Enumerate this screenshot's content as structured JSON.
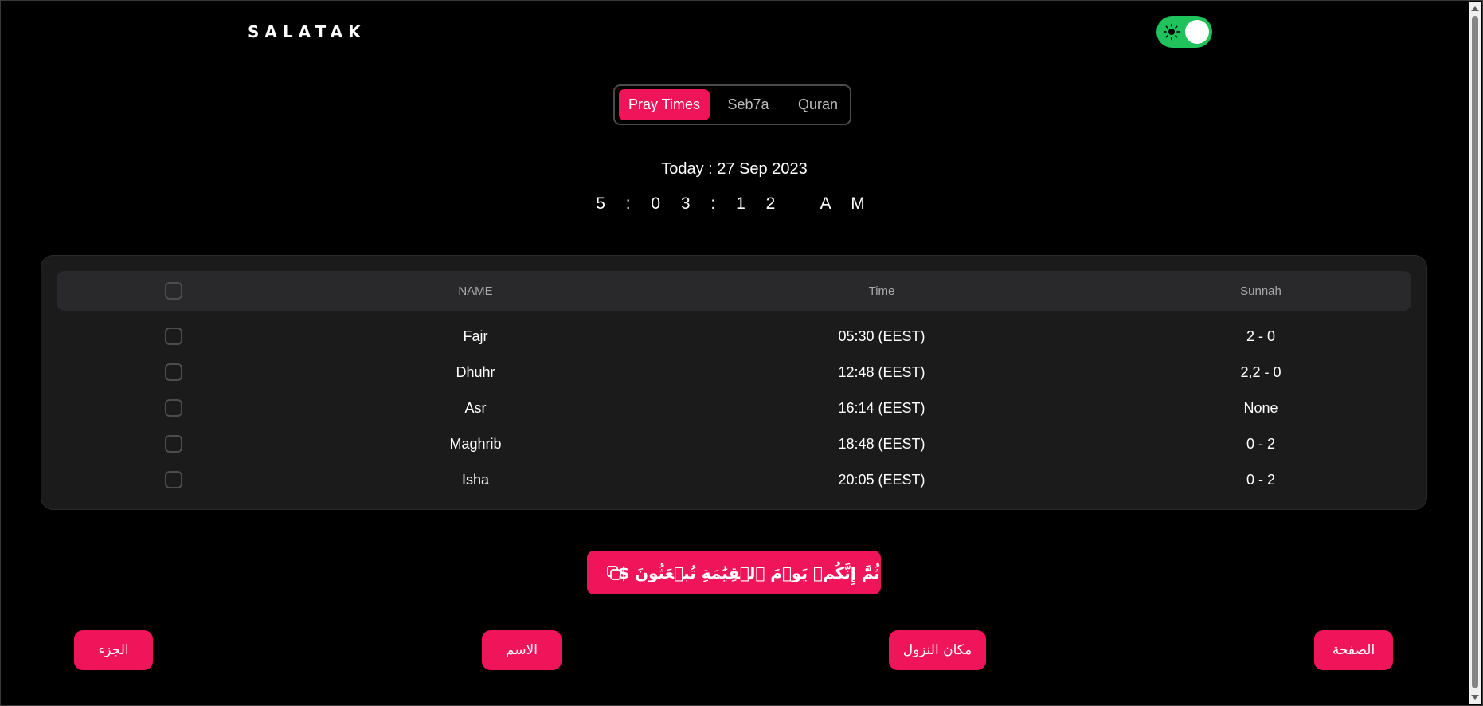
{
  "brand": "SALATAK",
  "theme_toggle": {
    "state": "on",
    "icon": "sun-icon",
    "color": "#1fc25b"
  },
  "tabs": [
    {
      "label": "Pray Times",
      "active": true
    },
    {
      "label": "Seb7a",
      "active": false
    },
    {
      "label": "Quran",
      "active": false
    }
  ],
  "date_text": "Today : 27 Sep 2023",
  "clock_text": "5 : 0 3 : 1 2   A M",
  "table": {
    "headers": {
      "name": "NAME",
      "time": "Time",
      "sunnah": "Sunnah"
    },
    "rows": [
      {
        "name": "Fajr",
        "time": "05:30 (EEST)",
        "sunnah": "2 - 0"
      },
      {
        "name": "Dhuhr",
        "time": "12:48 (EEST)",
        "sunnah": "2,2 - 0"
      },
      {
        "name": "Asr",
        "time": "16:14 (EEST)",
        "sunnah": "None"
      },
      {
        "name": "Maghrib",
        "time": "18:48 (EEST)",
        "sunnah": "0 - 2"
      },
      {
        "name": "Isha",
        "time": "20:05 (EEST)",
        "sunnah": "0 - 2"
      }
    ]
  },
  "verse": {
    "text": "ثُمَّ إِنَّكُمۡ يَوۡمَ ٱلۡقِيَٰمَةِ تُبۡعَثُونَ $",
    "icon": "copy-icon"
  },
  "buttons": {
    "juz": "الجزء",
    "name": "الاسم",
    "revelation_place": "مكان النزول",
    "page": "الصفحة"
  },
  "colors": {
    "accent": "#f0145a",
    "toggle_green": "#1fc25b",
    "background": "#000000",
    "card": "#1b1b1c"
  }
}
